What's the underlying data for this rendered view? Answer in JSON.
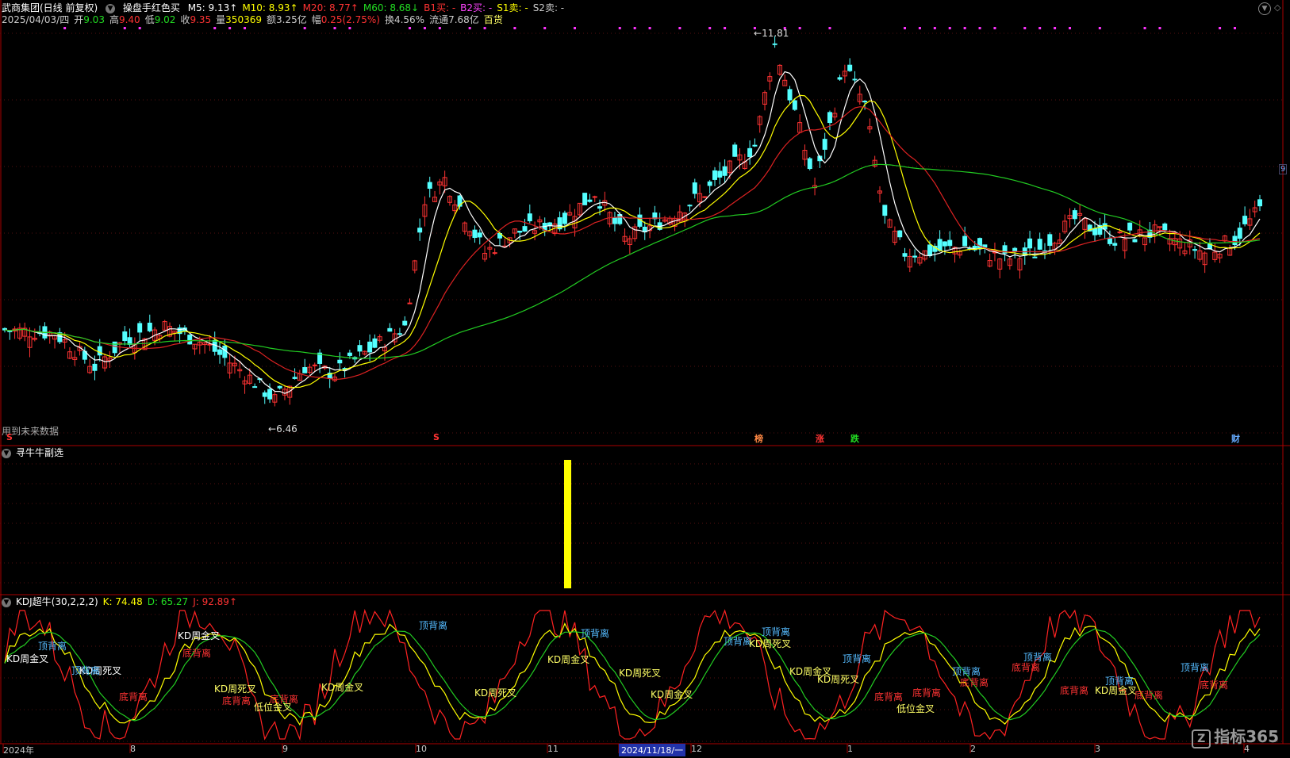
{
  "main": {
    "header": {
      "stock_name": "武商集团(日线 前复权)",
      "indicator_name": "操盘手红色买",
      "ma": [
        {
          "label": "M5: 9.13",
          "arrow": "↑",
          "color": "#ffffff"
        },
        {
          "label": "M10: 8.93",
          "arrow": "↑",
          "color": "#ffff00"
        },
        {
          "label": "M20: 8.77",
          "arrow": "↑",
          "color": "#ff3333"
        },
        {
          "label": "M60: 8.68",
          "arrow": "↓",
          "color": "#22dd22"
        },
        {
          "label": "B1买: -",
          "arrow": "",
          "color": "#ff3333"
        },
        {
          "label": "B2买: -",
          "arrow": "",
          "color": "#ff44ff"
        },
        {
          "label": "S1卖: -",
          "arrow": "",
          "color": "#ffff00"
        },
        {
          "label": "S2卖: -",
          "arrow": "",
          "color": "#cccccc"
        }
      ]
    },
    "quote": {
      "date": "2025/04/03/四",
      "open_label": "开",
      "open": "9.03",
      "high_label": "高",
      "high": "9.40",
      "low_label": "低",
      "low": "9.02",
      "close_label": "收",
      "close": "9.35",
      "vol_label": "量",
      "vol": "350369",
      "amount": "额3.25亿",
      "chg_label": "幅",
      "chg": "0.25(2.75%)",
      "turnover": "换4.56%",
      "float": "流通7.68亿",
      "sector": "百货"
    },
    "price_high_label": "11.81",
    "price_low_label": "6.46",
    "future_data_label": "用到未来数据",
    "event_markers": [
      {
        "text": "S",
        "color": "#ff3333"
      },
      {
        "text": "S",
        "color": "#ff3333"
      },
      {
        "text": "榜",
        "color": "#ff8844"
      },
      {
        "text": "涨",
        "color": "#ff3333"
      },
      {
        "text": "跌",
        "color": "#22dd22"
      },
      {
        "text": "财",
        "color": "#66aaff"
      }
    ],
    "right_scale_label": "9"
  },
  "sub1": {
    "title": "寻牛牛副选"
  },
  "kdj": {
    "title": "KDJ超牛(30,2,2,2)",
    "k_label": "K: 74.48",
    "d_label": "D: 65.27",
    "j_label": "J: 92.89",
    "j_arrow": "↑",
    "annotations": [
      {
        "text": "KD周金叉",
        "color": "#ffffff"
      },
      {
        "text": "顶背离",
        "color": "#55bbff"
      },
      {
        "text": "KD周死叉",
        "color": "#ffffff"
      },
      {
        "text": "底背离",
        "color": "#ff3333"
      },
      {
        "text": "KD周金叉",
        "color": "#ffffff"
      },
      {
        "text": "顶背离",
        "color": "#55bbff"
      },
      {
        "text": "底背离",
        "color": "#ff3333"
      },
      {
        "text": "KD周死叉",
        "color": "#ffff66"
      },
      {
        "text": "底背离",
        "color": "#ff3333"
      },
      {
        "text": "低位金叉",
        "color": "#ffff66"
      },
      {
        "text": "底背离",
        "color": "#ff3333"
      },
      {
        "text": "KD周金叉",
        "color": "#ffff66"
      },
      {
        "text": "顶背离",
        "color": "#55bbff"
      },
      {
        "text": "KD周死叉",
        "color": "#ffff66"
      },
      {
        "text": "顶背离",
        "color": "#55bbff"
      },
      {
        "text": "KD周金叉",
        "color": "#ffff66"
      },
      {
        "text": "KD周死叉",
        "color": "#ffff66"
      },
      {
        "text": "KD周金叉",
        "color": "#ffff66"
      },
      {
        "text": "顶背离",
        "color": "#55bbff"
      },
      {
        "text": "顶背离",
        "color": "#55bbff"
      },
      {
        "text": "KD周死叉",
        "color": "#ffff66"
      },
      {
        "text": "KD周金叉",
        "color": "#ffff66"
      },
      {
        "text": "KD周死叉",
        "color": "#ffff66"
      },
      {
        "text": "顶背离",
        "color": "#55bbff"
      },
      {
        "text": "底背离",
        "color": "#ff3333"
      },
      {
        "text": "低位金叉",
        "color": "#ffff66"
      },
      {
        "text": "底背离",
        "color": "#ff3333"
      },
      {
        "text": "顶背离",
        "color": "#55bbff"
      },
      {
        "text": "底背离",
        "color": "#ff3333"
      },
      {
        "text": "顶背离",
        "color": "#55bbff"
      },
      {
        "text": "底背离",
        "color": "#ff3333"
      },
      {
        "text": "底背离",
        "color": "#ff3333"
      },
      {
        "text": "顶背离",
        "color": "#55bbff"
      },
      {
        "text": "KD周金叉",
        "color": "#ffff66"
      },
      {
        "text": "底背离",
        "color": "#ff3333"
      },
      {
        "text": "顶背离",
        "color": "#55bbff"
      },
      {
        "text": "底背离",
        "color": "#ff3333"
      }
    ]
  },
  "xaxis": {
    "labels": [
      "2024年",
      "8",
      "9",
      "10",
      "11",
      "2024/11/18/一",
      "12",
      "1",
      "2",
      "3",
      "4"
    ]
  },
  "watermark": "指标365"
}
